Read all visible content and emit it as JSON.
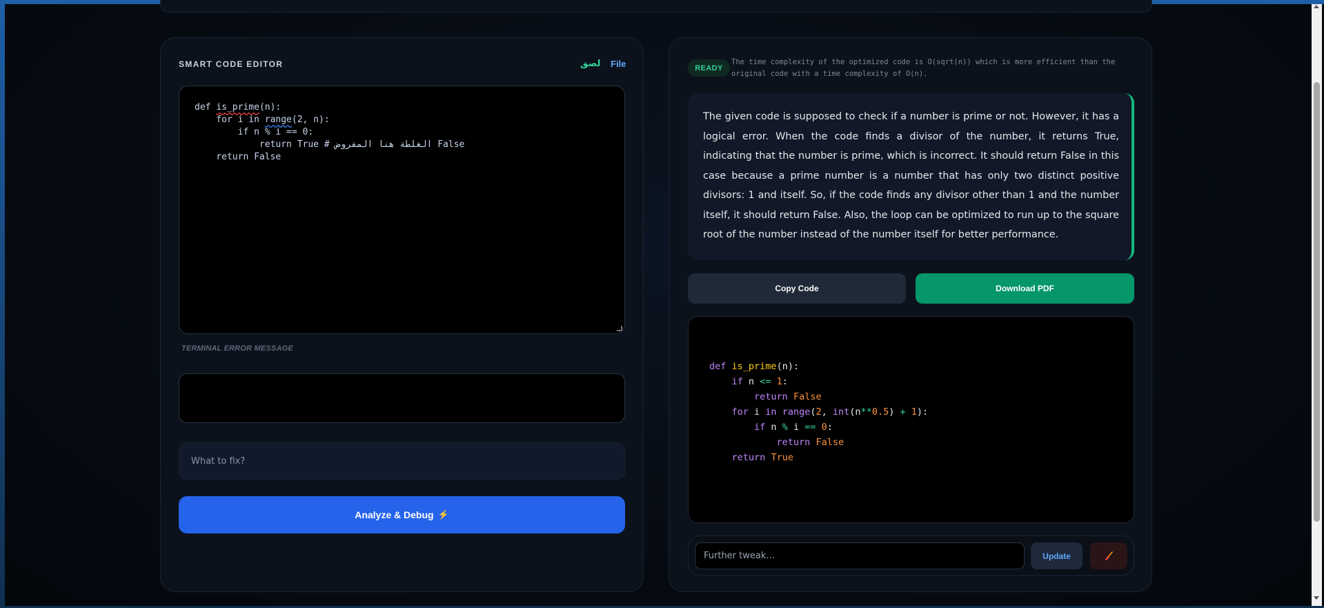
{
  "editor": {
    "title": "SMART CODE EDITOR",
    "paste_label": "لصق",
    "file_label": "File",
    "code_lines": [
      "def is_prime(n):",
      "    for i in range(2, n):",
      "        if n % i == 0:",
      "            return True # الغلطة هنا المفروض False",
      "    return False"
    ],
    "terminal_label": "TERMINAL ERROR MESSAGE",
    "terminal_value": "",
    "fix_placeholder": "What to fix?",
    "analyze_label": "Analyze & Debug",
    "analyze_icon": "⚡"
  },
  "result": {
    "status": "READY",
    "complexity_note": "The time complexity of the optimized code is O(sqrt(n)) which is more efficient than the original code with a time complexity of O(n).",
    "explanation": "The given code is supposed to check if a number is prime or not. However, it has a logical error. When the code finds a divisor of the number, it returns True, indicating that the number is prime, which is incorrect. It should return False in this case because a prime number is a number that has only two distinct positive divisors: 1 and itself. So, if the code finds any divisor other than 1 and the number itself, it should return False. Also, the loop can be optimized to run up to the square root of the number instead of the number itself for better performance.",
    "copy_label": "Copy Code",
    "pdf_label": "Download PDF",
    "tweak_placeholder": "Further tweak...",
    "update_label": "Update",
    "clear_icon": "broom-icon"
  },
  "colors": {
    "accent_blue": "#2563eb",
    "accent_green": "#059669",
    "ready_green": "#34d399"
  }
}
